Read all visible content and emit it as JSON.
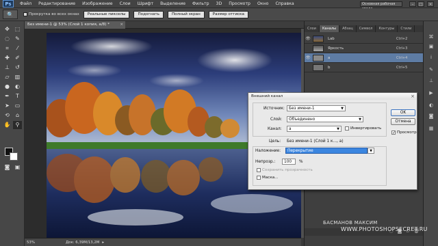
{
  "app": {
    "logo": "Ps",
    "menu": [
      "Файл",
      "Редактирование",
      "Изображение",
      "Слои",
      "Шрифт",
      "Выделение",
      "Фильтр",
      "3D",
      "Просмотр",
      "Окно",
      "Справка"
    ],
    "workspace": "Основная рабочая среда"
  },
  "options_bar": {
    "tool_icon": "zoom-icon",
    "scroll_all_label": "Прокрутка во всех окнах",
    "buttons": [
      "Реальные пикселы",
      "Подогнать",
      "Полный экран",
      "Размер оттиска"
    ]
  },
  "document": {
    "tab_title": "Без имени-1 @ 53% (Слой 1 копия, a/8) *",
    "zoom": "53%",
    "doc_info": "Док: 6,39M/13,2M"
  },
  "panels": {
    "tabs": [
      "Слои",
      "Каналы",
      "Абзац",
      "Символ",
      "Контуры",
      "Стили"
    ],
    "active_tab": "Каналы",
    "channels": [
      {
        "name": "Lab",
        "key": "Ctrl+2",
        "visible": true
      },
      {
        "name": "Яркость",
        "key": "Ctrl+3",
        "visible": false
      },
      {
        "name": "a",
        "key": "Ctrl+4",
        "visible": true
      },
      {
        "name": "b",
        "key": "Ctrl+5",
        "visible": false
      }
    ]
  },
  "dialog": {
    "title": "Внешний канал",
    "source_label": "Источник:",
    "source_value": "Без имени-1",
    "layer_label": "Слой:",
    "layer_value": "Объединено",
    "channel_label": "Канал:",
    "channel_value": "a",
    "invert_label": "Инвертировать",
    "target_label": "Цель:",
    "target_value": "Без имени-1 (Слой 1 к..., a)",
    "blending_label": "Наложение:",
    "blending_value": "Перекрытие",
    "opacity_label": "Непрозр.:",
    "opacity_value": "100",
    "opacity_unit": "%",
    "preserve_label": "Сохранить прозрачность",
    "mask_label": "Маска...",
    "ok_label": "OK",
    "cancel_label": "Отмена",
    "preview_label": "Просмотр",
    "preview_checked": true
  },
  "watermark": {
    "line1": "БАСМАНОВ МАКСИМ",
    "line2": "WWW.PHOTOSHOPSECRET.RU"
  },
  "colors": {
    "accent": "#3a72c0",
    "selection": "#3b86e0"
  }
}
